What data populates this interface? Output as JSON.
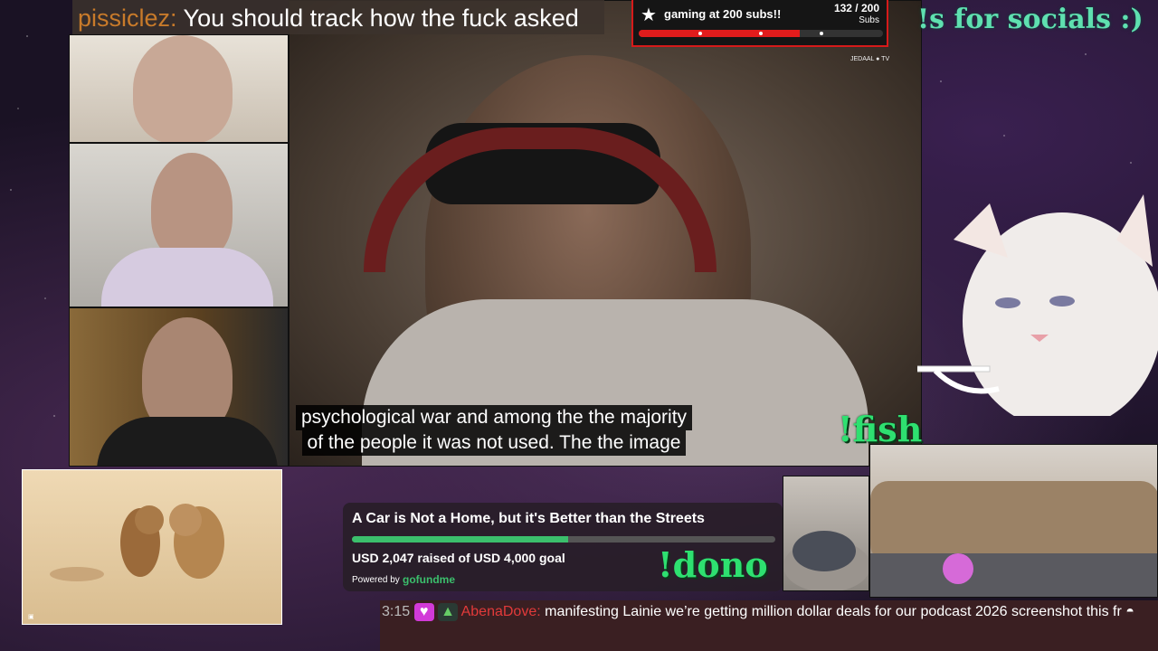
{
  "top_chat": {
    "user": "pissiclez:",
    "message": "You should track how the fuck asked"
  },
  "sub_goal": {
    "title": "gaming at 200 subs!!",
    "count": "132 / 200",
    "unit": "Subs",
    "progress": 0.66
  },
  "socials_text": "!s for socials :)",
  "watermark": "JEDAAL ● TV",
  "caption": {
    "line1": "psychological war and among the the majority",
    "line2": "of the people it was not used. The the image"
  },
  "fish_command": "!fish",
  "gofundme": {
    "title": "A Car is Not a Home, but it's Better than the Streets",
    "raised": "USD 2,047 raised of USD 4,000 goal",
    "progress": 0.51,
    "powered_by": "Powered by",
    "brand": "gofundme"
  },
  "dono_command": "!dono",
  "bottom_chat": {
    "time": "3:15",
    "user": "AbenaDove:",
    "message": "manifesting Lainie we’re getting million dollar deals for our podcast 2026 screenshot this fr"
  },
  "colors": {
    "accent_green": "#2ee070",
    "teal": "#5fe0b0",
    "goal_red": "#e11c1c",
    "gofundme_green": "#3bbf6c"
  }
}
